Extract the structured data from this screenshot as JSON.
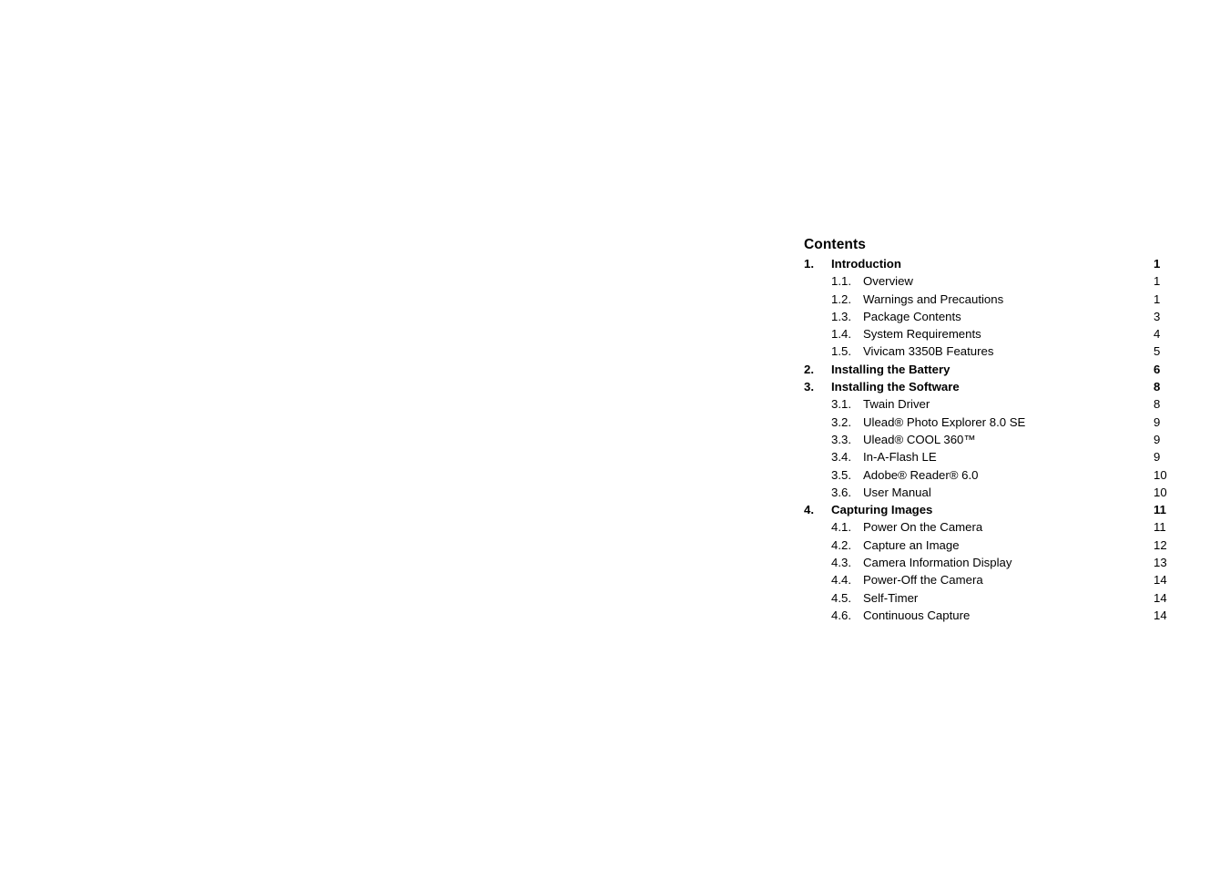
{
  "document": {
    "heading": "Contents",
    "page_background": "#ffffff",
    "text_color": "#000000"
  },
  "toc": {
    "entries": [
      {
        "level": 1,
        "number": "1.",
        "label": "Introduction",
        "page": "1"
      },
      {
        "level": 2,
        "number": "1.1.",
        "label": "Overview",
        "page": "1"
      },
      {
        "level": 2,
        "number": "1.2.",
        "label": "Warnings and Precautions",
        "page": "1"
      },
      {
        "level": 2,
        "number": "1.3.",
        "label": "Package Contents",
        "page": "3"
      },
      {
        "level": 2,
        "number": "1.4.",
        "label": "System Requirements",
        "page": "4"
      },
      {
        "level": 2,
        "number": "1.5.",
        "label": "Vivicam 3350B Features",
        "page": "5"
      },
      {
        "level": 1,
        "number": "2.",
        "label": "Installing the Battery",
        "page": "6"
      },
      {
        "level": 1,
        "number": "3.",
        "label": "Installing the Software",
        "page": "8"
      },
      {
        "level": 2,
        "number": "3.1.",
        "label": "Twain Driver",
        "page": "8"
      },
      {
        "level": 2,
        "number": "3.2.",
        "label": "Ulead® Photo Explorer 8.0 SE",
        "page": "9"
      },
      {
        "level": 2,
        "number": "3.3.",
        "label": "Ulead® COOL 360™",
        "page": "9"
      },
      {
        "level": 2,
        "number": "3.4.",
        "label": "In-A-Flash LE",
        "page": "9"
      },
      {
        "level": 2,
        "number": "3.5.",
        "label": "Adobe® Reader® 6.0",
        "page": "10"
      },
      {
        "level": 2,
        "number": "3.6.",
        "label": "User Manual",
        "page": "10"
      },
      {
        "level": 1,
        "number": "4.",
        "label": "Capturing Images",
        "page": "11"
      },
      {
        "level": 2,
        "number": "4.1.",
        "label": "Power On the Camera",
        "page": "11"
      },
      {
        "level": 2,
        "number": "4.2.",
        "label": "Capture an Image",
        "page": "12"
      },
      {
        "level": 2,
        "number": "4.3.",
        "label": "Camera Information Display",
        "page": "13"
      },
      {
        "level": 2,
        "number": "4.4.",
        "label": "Power-Off the Camera",
        "page": "14"
      },
      {
        "level": 2,
        "number": "4.5.",
        "label": "Self-Timer",
        "page": "14"
      },
      {
        "level": 2,
        "number": "4.6.",
        "label": "Continuous Capture",
        "page": "14"
      }
    ]
  }
}
